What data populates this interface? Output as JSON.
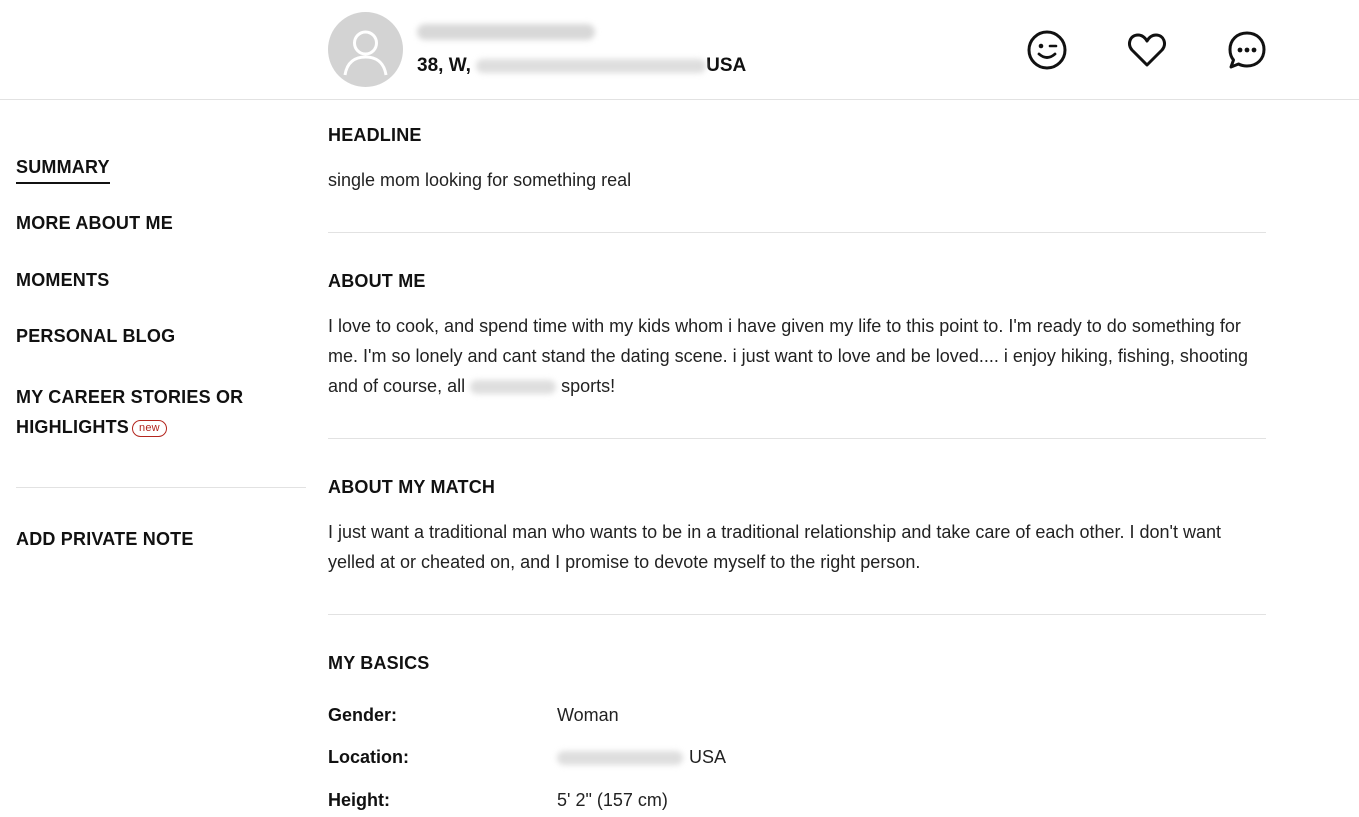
{
  "profile": {
    "subline_prefix": "38, W,",
    "subline_suffix": "USA",
    "actions": {
      "wink_icon": "wink-face-icon",
      "like_icon": "heart-icon",
      "message_icon": "chat-bubble-icon"
    }
  },
  "sidebar": {
    "items": [
      {
        "label": "SUMMARY"
      },
      {
        "label": "MORE ABOUT ME"
      },
      {
        "label": "MOMENTS"
      },
      {
        "label": "PERSONAL BLOG"
      },
      {
        "label_line1": "MY CAREER STORIES OR",
        "label_line2": "HIGHLIGHTS",
        "badge": "new"
      }
    ],
    "private_note": "ADD PRIVATE NOTE"
  },
  "sections": {
    "headline": {
      "title": "HEADLINE",
      "text": "single mom looking for something real"
    },
    "about_me": {
      "title": "ABOUT ME",
      "text_part1": "I love to cook, and spend time with my kids whom i have given my life to this point to. I'm ready to do something for me. I'm so lonely and cant stand the dating scene. i just want to love and be loved.... i enjoy hiking, fishing, shooting and of course, all",
      "text_part2": "sports!"
    },
    "about_match": {
      "title": "ABOUT MY MATCH",
      "text": "I just want a traditional man who wants to be in a traditional relationship and take care of each other. I don't want yelled at or cheated on, and I promise to devote myself to the right person."
    },
    "basics": {
      "title": "MY BASICS",
      "rows": [
        {
          "label": "Gender:",
          "value": "Woman"
        },
        {
          "label": "Location:",
          "value": "USA"
        },
        {
          "label": "Height:",
          "value": "5' 2\" (157 cm)"
        }
      ]
    }
  }
}
